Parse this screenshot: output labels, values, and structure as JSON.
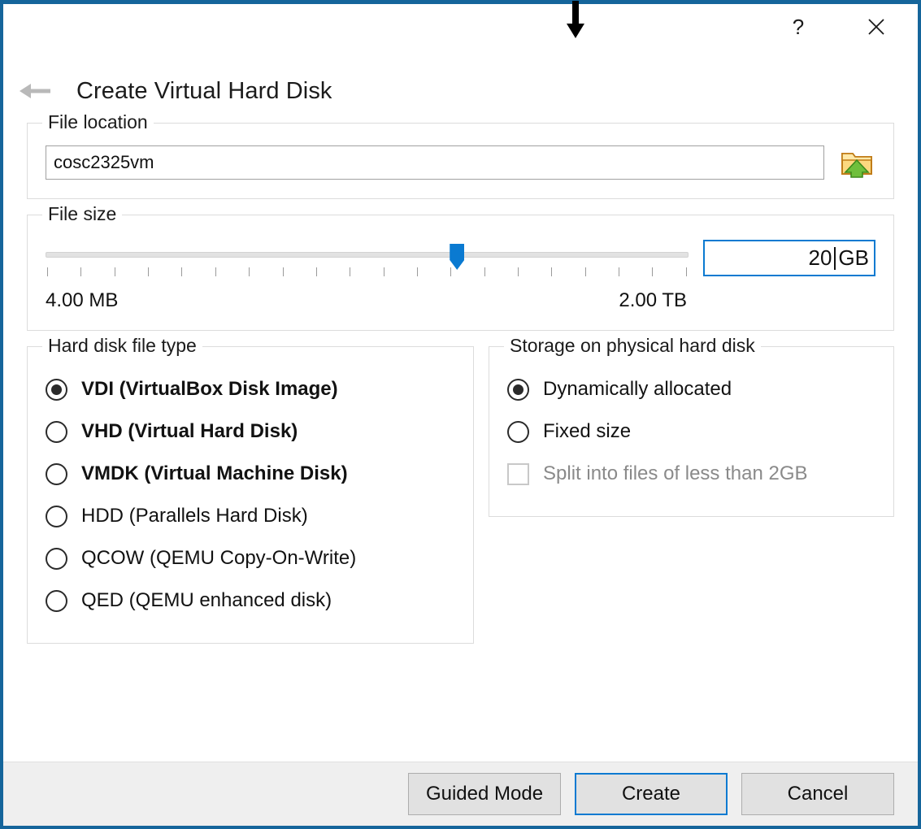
{
  "window": {
    "border_color": "#15659b",
    "titlebar": {
      "help_label": "?",
      "close_label": "✕"
    },
    "annotation": {
      "arrow": "down-arrow-annotation"
    }
  },
  "header": {
    "back_icon": "back-arrow-icon",
    "title": "Create Virtual Hard Disk"
  },
  "file_location": {
    "legend": "File location",
    "value": "cosc2325vm",
    "placeholder": "",
    "browse_icon": "folder-open-icon"
  },
  "file_size": {
    "legend": "File size",
    "slider": {
      "min_label": "4.00 MB",
      "max_label": "2.00 TB",
      "tick_count": 20,
      "handle_percent": 64
    },
    "spinbox": {
      "value": "20",
      "unit": "GB",
      "caret_visible": true,
      "focus_color": "#0a7ad1"
    }
  },
  "hard_disk_file_type": {
    "legend": "Hard disk file type",
    "options": [
      {
        "label": "VDI (VirtualBox Disk Image)",
        "selected": true,
        "bold": true
      },
      {
        "label": "VHD (Virtual Hard Disk)",
        "selected": false,
        "bold": true
      },
      {
        "label": "VMDK (Virtual Machine Disk)",
        "selected": false,
        "bold": true
      },
      {
        "label": "HDD (Parallels Hard Disk)",
        "selected": false,
        "bold": false
      },
      {
        "label": "QCOW (QEMU Copy-On-Write)",
        "selected": false,
        "bold": false
      },
      {
        "label": "QED (QEMU enhanced disk)",
        "selected": false,
        "bold": false
      }
    ]
  },
  "storage": {
    "legend": "Storage on physical hard disk",
    "options": [
      {
        "label": "Dynamically allocated",
        "selected": true,
        "type": "radio"
      },
      {
        "label": "Fixed size",
        "selected": false,
        "type": "radio"
      }
    ],
    "split_checkbox": {
      "label": "Split into files of less than 2GB",
      "checked": false,
      "disabled": true
    }
  },
  "footer": {
    "buttons": [
      {
        "label": "Guided Mode",
        "default": false
      },
      {
        "label": "Create",
        "default": true
      },
      {
        "label": "Cancel",
        "default": false
      }
    ]
  }
}
